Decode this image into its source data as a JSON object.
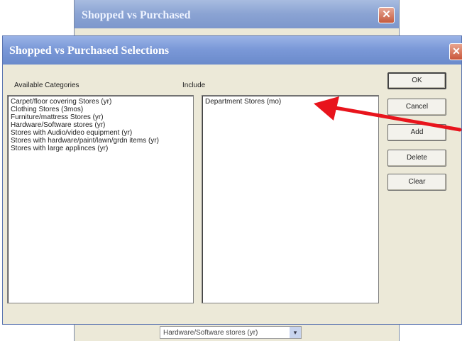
{
  "background_window": {
    "title": "Shopped vs Purchased",
    "close_glyph": "✕",
    "combo_value": "Hardware/Software stores (yr)",
    "combo_arrow": "▾"
  },
  "dialog": {
    "title": "Shopped vs Purchased Selections",
    "close_glyph": "✕",
    "available_label": "Available Categories",
    "include_label": "Include",
    "available_items": [
      "Carpet/floor covering Stores (yr)",
      "Clothing Stores (3mos)",
      "Furniture/mattress Stores (yr)",
      "Hardware/Software stores (yr)",
      "Stores with Audio/video equipment (yr)",
      "Stores with hardware/paint/lawn/grdn items (yr)",
      "Stores with large applinces (yr)"
    ],
    "include_items": [
      "Department Stores (mo)"
    ],
    "buttons": {
      "ok": "OK",
      "cancel": "Cancel",
      "add": "Add",
      "delete": "Delete",
      "clear": "Clear"
    }
  },
  "annotation": {
    "arrow_color": "#e8141c",
    "arrow_icon": "red-arrow-icon"
  }
}
